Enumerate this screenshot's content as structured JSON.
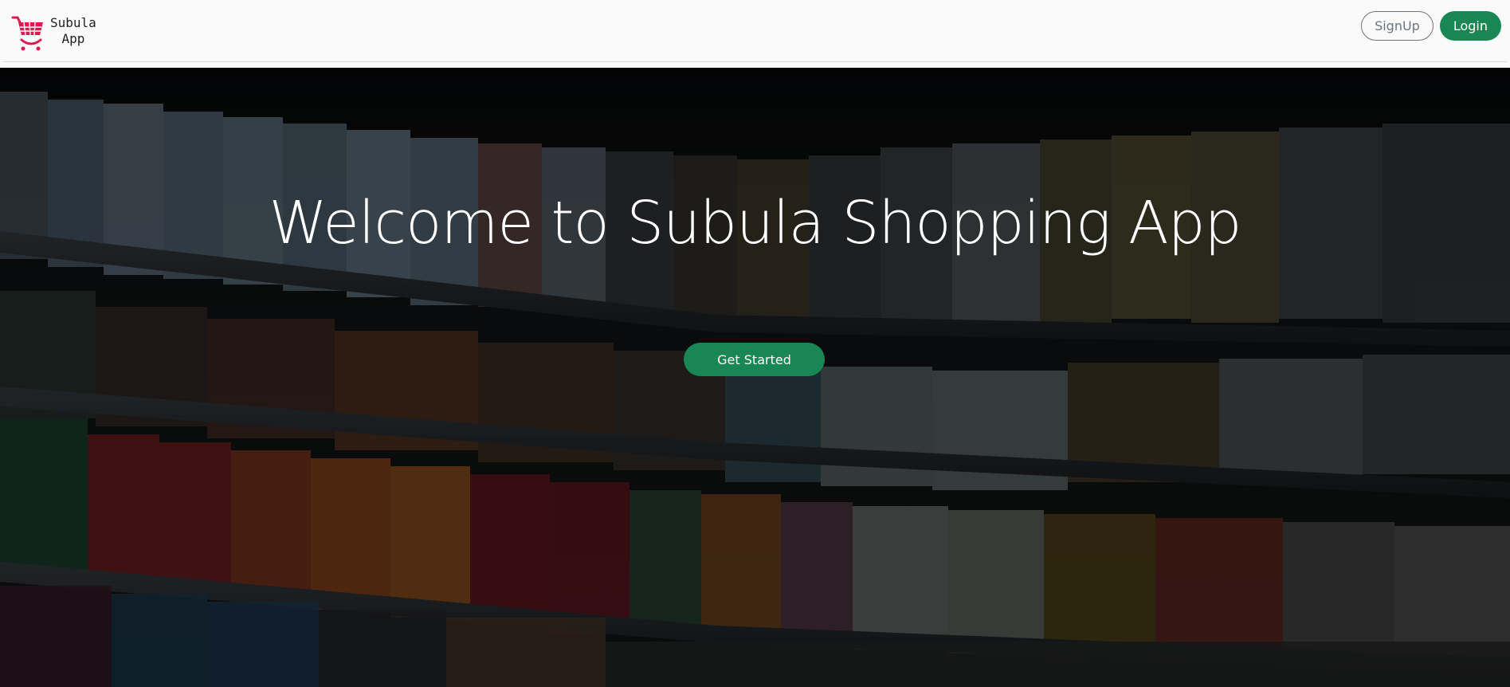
{
  "brand": {
    "logo_icon": "shopping-cart-smile-icon",
    "name_line1": "Subula",
    "name_line2": "App"
  },
  "nav": {
    "signup_label": "SignUp",
    "login_label": "Login"
  },
  "hero": {
    "title": "Welcome to Subula Shopping App",
    "cta_label": "Get Started"
  },
  "colors": {
    "brand_green": "#198754",
    "logo_pink": "#e3174f",
    "outline_gray": "#6c757d"
  }
}
